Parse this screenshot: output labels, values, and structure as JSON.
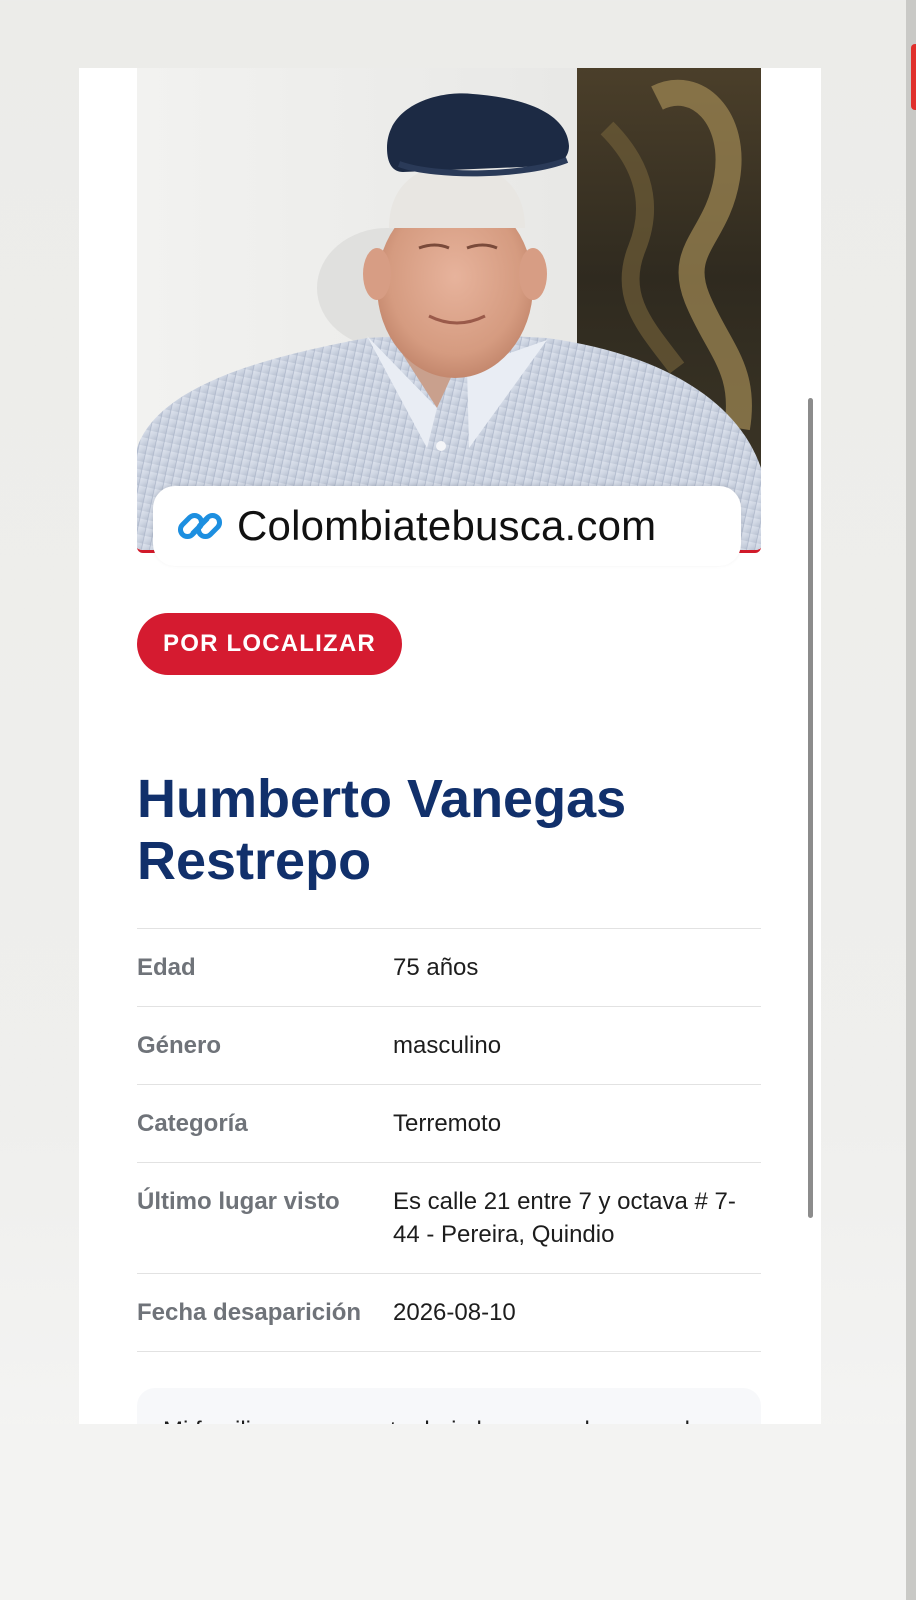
{
  "photo": {
    "subject": "Portrait of elderly man wearing a dark flat cap and light striped shirt"
  },
  "site_badge": {
    "icon": "link-icon",
    "text": "Colombiatebusca.com"
  },
  "status": {
    "label": "POR LOCALIZAR",
    "color": "#d51b30"
  },
  "person": {
    "name": "Humberto Vanegas Restrepo"
  },
  "details": [
    {
      "label": "Edad",
      "value": "75 años"
    },
    {
      "label": "Género",
      "value": "masculino"
    },
    {
      "label": "Categoría",
      "value": "Terremoto"
    },
    {
      "label": "Último lugar visto",
      "value": "Es calle 21 entre 7 y octava # 7-44 - Pereira, Quindio"
    },
    {
      "label": "Fecha desaparición",
      "value": "2026-08-10"
    }
  ],
  "note": {
    "text": "Mi familiar se encuentra bajo los escombros en el segundo piso de la edificación."
  },
  "colors": {
    "name": "#11306b",
    "accent": "#d51b30",
    "link_icon": "#1d8fe0"
  }
}
